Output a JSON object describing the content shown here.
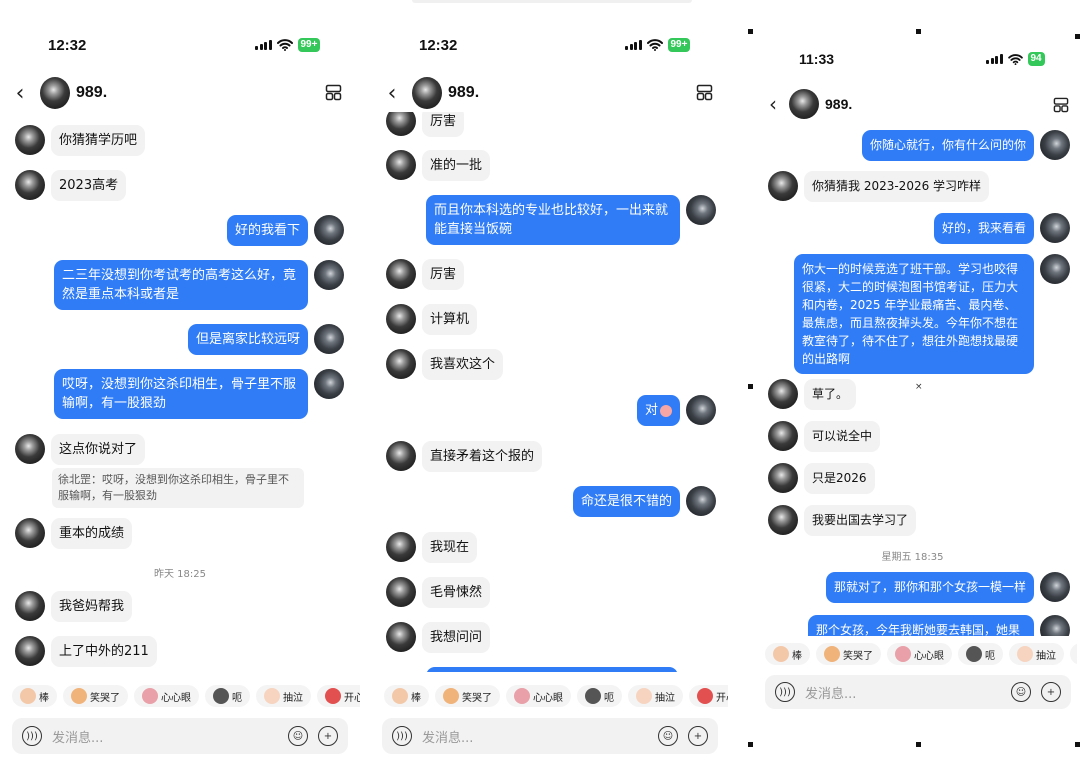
{
  "phone1": {
    "time": "12:32",
    "battery": "99+",
    "chat_name": "989.",
    "messages": [
      {
        "side": "left",
        "text": "你猜猜学历吧"
      },
      {
        "side": "left",
        "text": "2023高考"
      },
      {
        "side": "right",
        "text": "好的我看下"
      },
      {
        "side": "right",
        "text": "二三年没想到你考试考的高考这么好，竟然是重点本科或者是"
      },
      {
        "side": "right",
        "text": "但是离家比较远呀"
      },
      {
        "side": "right",
        "text": "哎呀，没想到你这杀印相生，骨子里不服输啊，有一股狠劲"
      },
      {
        "side": "left",
        "text": "这点你说对了"
      },
      {
        "side": "left",
        "text": "重本的成绩"
      },
      {
        "side": "left",
        "text": "我爸妈帮我"
      },
      {
        "side": "left",
        "text": "上了中外的211"
      }
    ],
    "quote": "徐北罡：哎呀，没想到你这杀印相生，骨子里不服输啊，有一股狠劲",
    "timestamp": "昨天 18:25",
    "chips": [
      "棒",
      "笑哭了",
      "心心眼",
      "呃",
      "抽泣",
      "开心"
    ],
    "input_placeholder": "发消息..."
  },
  "phone2": {
    "time": "12:32",
    "battery": "99+",
    "chat_name": "989.",
    "messages": [
      {
        "side": "left",
        "text": "厉害"
      },
      {
        "side": "left",
        "text": "准的一批"
      },
      {
        "side": "right",
        "text": "而且你本科选的专业也比较好，一出来就能直接当饭碗"
      },
      {
        "side": "left",
        "text": "厉害"
      },
      {
        "side": "left",
        "text": "计算机"
      },
      {
        "side": "left",
        "text": "我喜欢这个"
      },
      {
        "side": "right",
        "text": "对"
      },
      {
        "side": "left",
        "text": "直接矛着这个报的"
      },
      {
        "side": "right",
        "text": "命还是很不错的"
      },
      {
        "side": "left",
        "text": "我现在"
      },
      {
        "side": "left",
        "text": "毛骨悚然"
      },
      {
        "side": "left",
        "text": "我想问问"
      }
    ],
    "chips": [
      "棒",
      "笑哭了",
      "心心眼",
      "呃",
      "抽泣",
      "开心"
    ],
    "input_placeholder": "发消息..."
  },
  "phone3": {
    "time": "11:33",
    "battery": "94",
    "chat_name": "989.",
    "messages": [
      {
        "side": "right",
        "text": "你随心就行，你有什么问的你"
      },
      {
        "side": "left",
        "text": "你猜猜我 2023-2026 学习咋样"
      },
      {
        "side": "right",
        "text": "好的，我来看看"
      },
      {
        "side": "right",
        "text": "你大一的时候竞选了班干部。学习也咬得很紧，大二的时候泡图书馆考证，压力大和内卷，2025 年学业最痛苦、最内卷、最焦虑，而且熬夜掉头发。今年你不想在教室待了，待不住了，想往外跑想找最硬的出路啊"
      },
      {
        "side": "left",
        "text": "草了。"
      },
      {
        "side": "left",
        "text": "可以说全中"
      },
      {
        "side": "left",
        "text": "只是2026"
      },
      {
        "side": "left",
        "text": "我要出国去学习了"
      },
      {
        "side": "right",
        "text": "那就对了，那你和那个女孩一模一样"
      },
      {
        "side": "right",
        "text": "那个女孩，今年我断她要去韩国，她果"
      }
    ],
    "timestamp": "星期五 18:35",
    "chips": [
      "棒",
      "笑哭了",
      "心心眼",
      "呃",
      "抽泣"
    ],
    "input_placeholder": "发消息..."
  },
  "icons": {
    "back": "chevron-left-icon",
    "menu": "layout-icon",
    "voice": "voice-icon",
    "emoji": "smiley-icon",
    "plus": "plus-icon"
  }
}
